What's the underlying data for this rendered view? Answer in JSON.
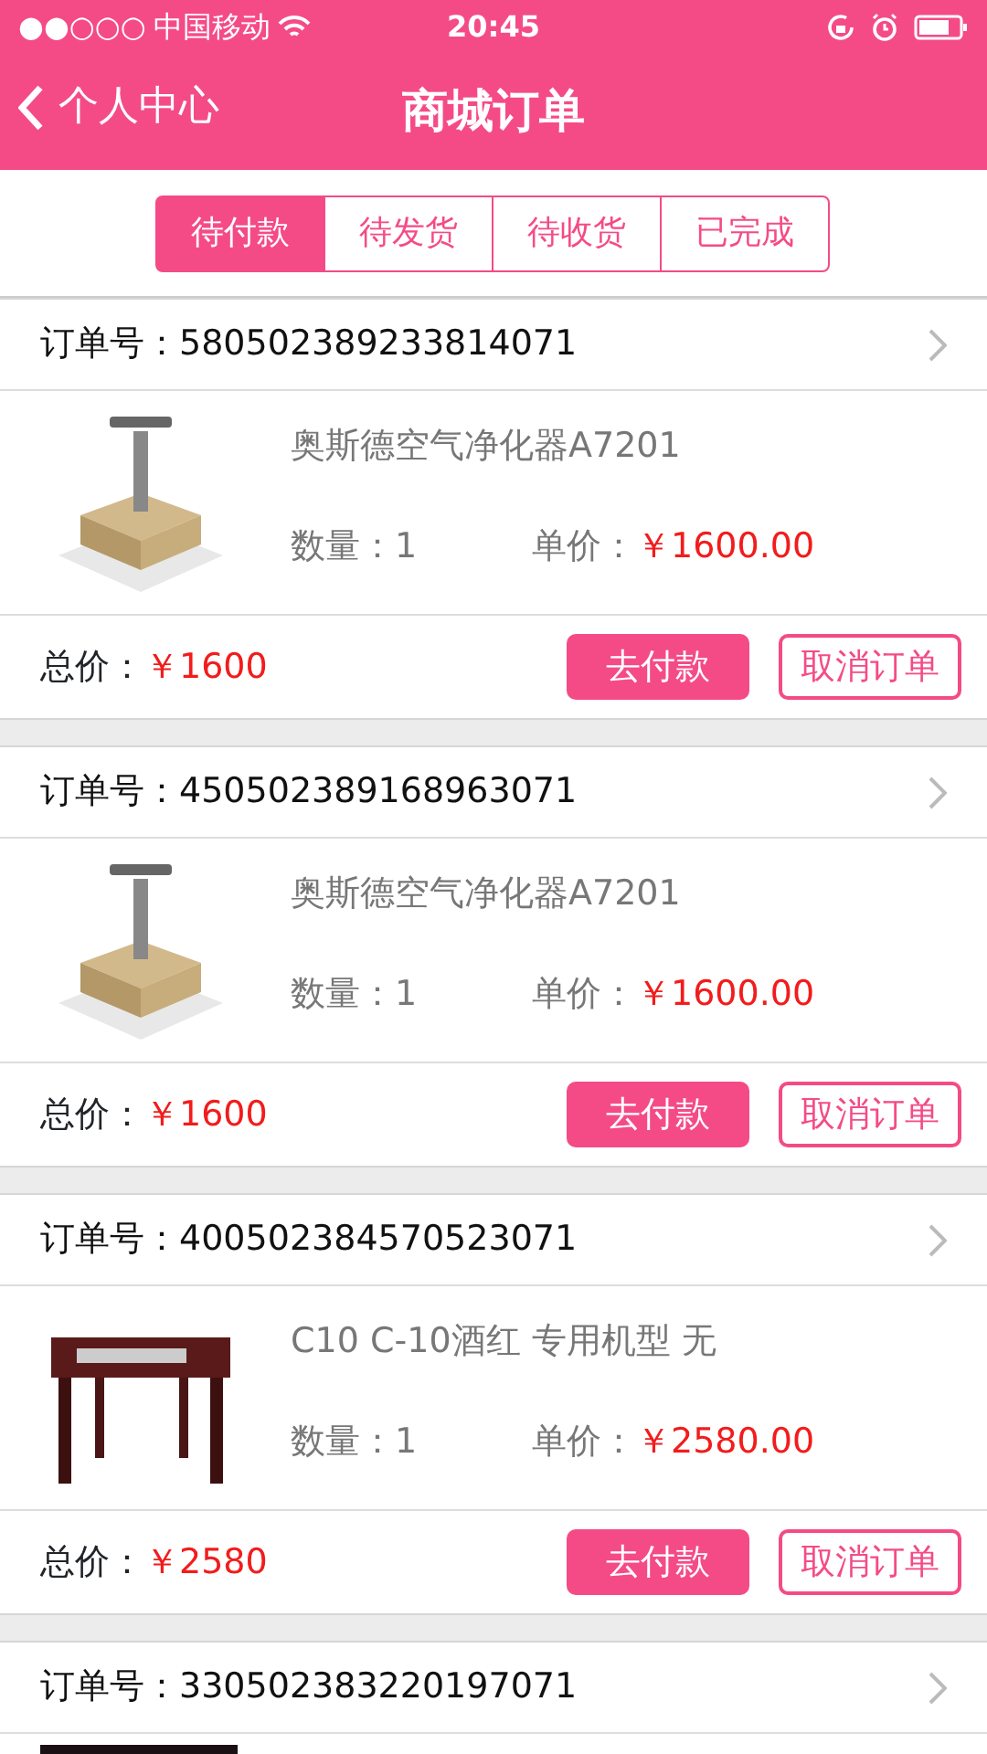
{
  "status_bar": {
    "signal": "●●○○○",
    "carrier": "中国移动",
    "time": "20:45"
  },
  "nav": {
    "back_label": "个人中心",
    "title": "商城订单"
  },
  "tabs": [
    {
      "label": "待付款",
      "selected": true
    },
    {
      "label": "待发货",
      "selected": false
    },
    {
      "label": "待收货",
      "selected": false
    },
    {
      "label": "已完成",
      "selected": false
    }
  ],
  "orders": [
    {
      "order_label": "订单号：",
      "order_no": "580502389233814071",
      "product": {
        "kind": "purifier",
        "name": "奥斯德空气净化器A7201",
        "qty_label": "数量：",
        "qty": "1",
        "price_label": "单价：",
        "price": "￥1600.00"
      },
      "total_label": "总价：",
      "total": "￥1600",
      "pay_button": "去付款",
      "cancel_button": "取消订单"
    },
    {
      "order_label": "订单号：",
      "order_no": "450502389168963071",
      "product": {
        "kind": "purifier",
        "name": "奥斯德空气净化器A7201",
        "qty_label": "数量：",
        "qty": "1",
        "price_label": "单价：",
        "price": "￥1600.00"
      },
      "total_label": "总价：",
      "total": "￥1600",
      "pay_button": "去付款",
      "cancel_button": "取消订单"
    },
    {
      "order_label": "订单号：",
      "order_no": "400502384570523071",
      "product": {
        "kind": "table",
        "name": "C10 C-10酒红 专用机型 无",
        "qty_label": "数量：",
        "qty": "1",
        "price_label": "单价：",
        "price": "￥2580.00"
      },
      "total_label": "总价：",
      "total": "￥2580",
      "pay_button": "去付款",
      "cancel_button": "取消订单"
    },
    {
      "order_label": "订单号：",
      "order_no": "330502383220197071",
      "product": {
        "kind": "photo"
      }
    }
  ]
}
